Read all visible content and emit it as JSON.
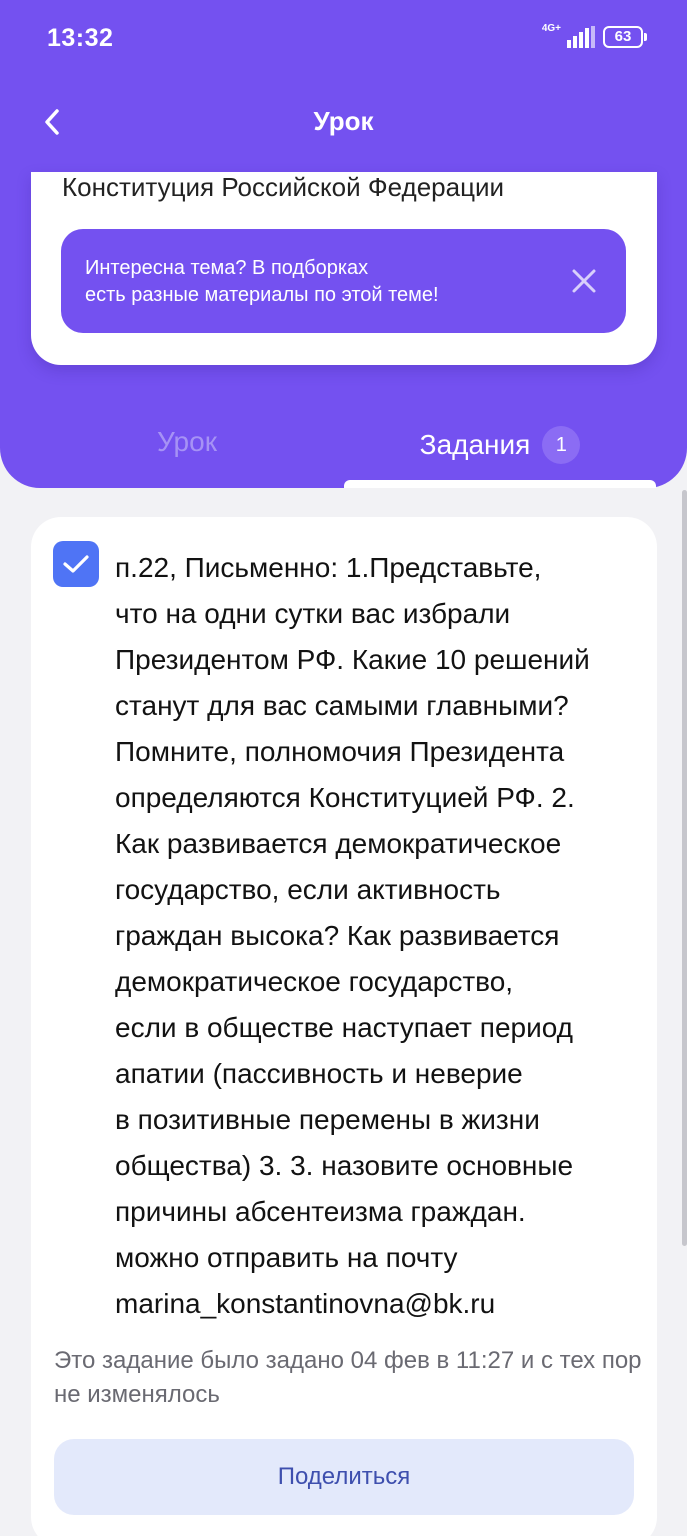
{
  "status_bar": {
    "time": "13:32",
    "network": "4G+",
    "battery": "63"
  },
  "nav": {
    "back_icon": "chevron-left-icon",
    "title": "Урок"
  },
  "lesson": {
    "title": "Конституция Российской Федерации",
    "promo": {
      "text": "Интересна тема? В подборках\nесть разные материалы по этой теме!",
      "close_icon": "close-icon"
    }
  },
  "tabs": [
    {
      "label": "Урок",
      "active": false
    },
    {
      "label": "Задания",
      "badge": "1",
      "active": true
    }
  ],
  "task": {
    "checked": true,
    "text": "п.22,  Письменно: 1.Представьте,\nчто на одни сутки вас избрали\nПрезидентом РФ. Какие 10 решений\nстанут для вас самыми главными?\nПомните, полномочия Президента\nопределяются Конституцией РФ.  2.\nКак развивается демократическое\nгосударство, если активность\nграждан высока? Как развивается\nдемократическое государство,\nесли в обществе наступает период\nапатии (пассивность и неверие\nв позитивные перемены в жизни\nобщества) 3. 3. назовите основные\nпричины абсентеизма граждан.\nможно отправить на почту\nmarina_konstantinovna@bk.ru",
    "note": "Это задание было задано 04 фев в 11:27 и с тех пор не изменялось",
    "share_label": "Поделиться"
  },
  "colors": {
    "accent": "#7451f0",
    "checkbox": "#4f74f5",
    "share_bg": "#e3e9fb",
    "share_text": "#3e4fae"
  }
}
